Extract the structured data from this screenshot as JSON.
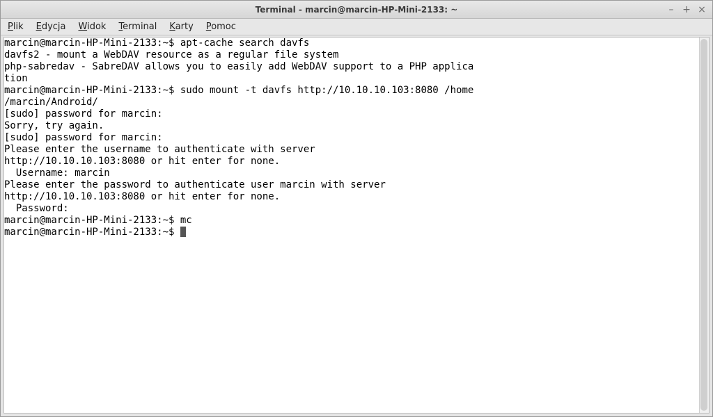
{
  "window": {
    "title": "Terminal - marcin@marcin-HP-Mini-2133: ~",
    "controls": {
      "minimize": "–",
      "maximize": "+",
      "close": "×"
    }
  },
  "menubar": {
    "items": [
      {
        "accel": "P",
        "rest": "lik"
      },
      {
        "accel": "E",
        "rest": "dycja"
      },
      {
        "accel": "W",
        "rest": "idok"
      },
      {
        "accel": "T",
        "rest": "erminal"
      },
      {
        "accel": "K",
        "rest": "arty"
      },
      {
        "accel": "P",
        "rest": "omoc"
      }
    ]
  },
  "terminal": {
    "lines": [
      {
        "text": "marcin@marcin-HP-Mini-2133:~$ apt-cache search davfs",
        "cursor": false
      },
      {
        "text": "davfs2 - mount a WebDAV resource as a regular file system",
        "cursor": false
      },
      {
        "text": "php-sabredav - SabreDAV allows you to easily add WebDAV support to a PHP applica",
        "cursor": false
      },
      {
        "text": "tion",
        "cursor": false
      },
      {
        "text": "marcin@marcin-HP-Mini-2133:~$ sudo mount -t davfs http://10.10.10.103:8080 /home",
        "cursor": false
      },
      {
        "text": "/marcin/Android/",
        "cursor": false
      },
      {
        "text": "[sudo] password for marcin: ",
        "cursor": false
      },
      {
        "text": "Sorry, try again.",
        "cursor": false
      },
      {
        "text": "[sudo] password for marcin: ",
        "cursor": false
      },
      {
        "text": "Please enter the username to authenticate with server",
        "cursor": false
      },
      {
        "text": "http://10.10.10.103:8080 or hit enter for none.",
        "cursor": false
      },
      {
        "text": "  Username: marcin",
        "cursor": false
      },
      {
        "text": "Please enter the password to authenticate user marcin with server",
        "cursor": false
      },
      {
        "text": "http://10.10.10.103:8080 or hit enter for none.",
        "cursor": false
      },
      {
        "text": "  Password:  ",
        "cursor": false
      },
      {
        "text": "marcin@marcin-HP-Mini-2133:~$ mc",
        "cursor": false
      },
      {
        "text": "",
        "cursor": false
      },
      {
        "text": "marcin@marcin-HP-Mini-2133:~$ ",
        "cursor": true
      }
    ]
  }
}
